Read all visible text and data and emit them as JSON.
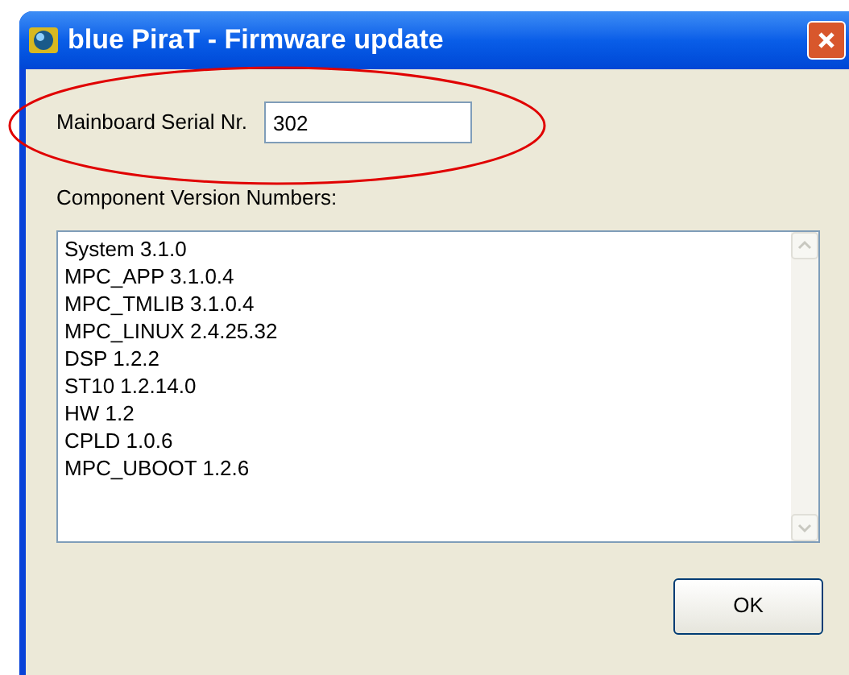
{
  "window": {
    "title": "blue PiraT - Firmware update"
  },
  "serial": {
    "label": "Mainboard Serial Nr.",
    "value": "302"
  },
  "components": {
    "label": "Component Version Numbers:",
    "lines": [
      "System 3.1.0",
      "MPC_APP 3.1.0.4",
      "MPC_TMLIB 3.1.0.4",
      "MPC_LINUX 2.4.25.32",
      "DSP 1.2.2",
      "ST10 1.2.14.0",
      "HW 1.2",
      "CPLD 1.0.6",
      "MPC_UBOOT 1.2.6"
    ]
  },
  "buttons": [
    "OK"
  ]
}
